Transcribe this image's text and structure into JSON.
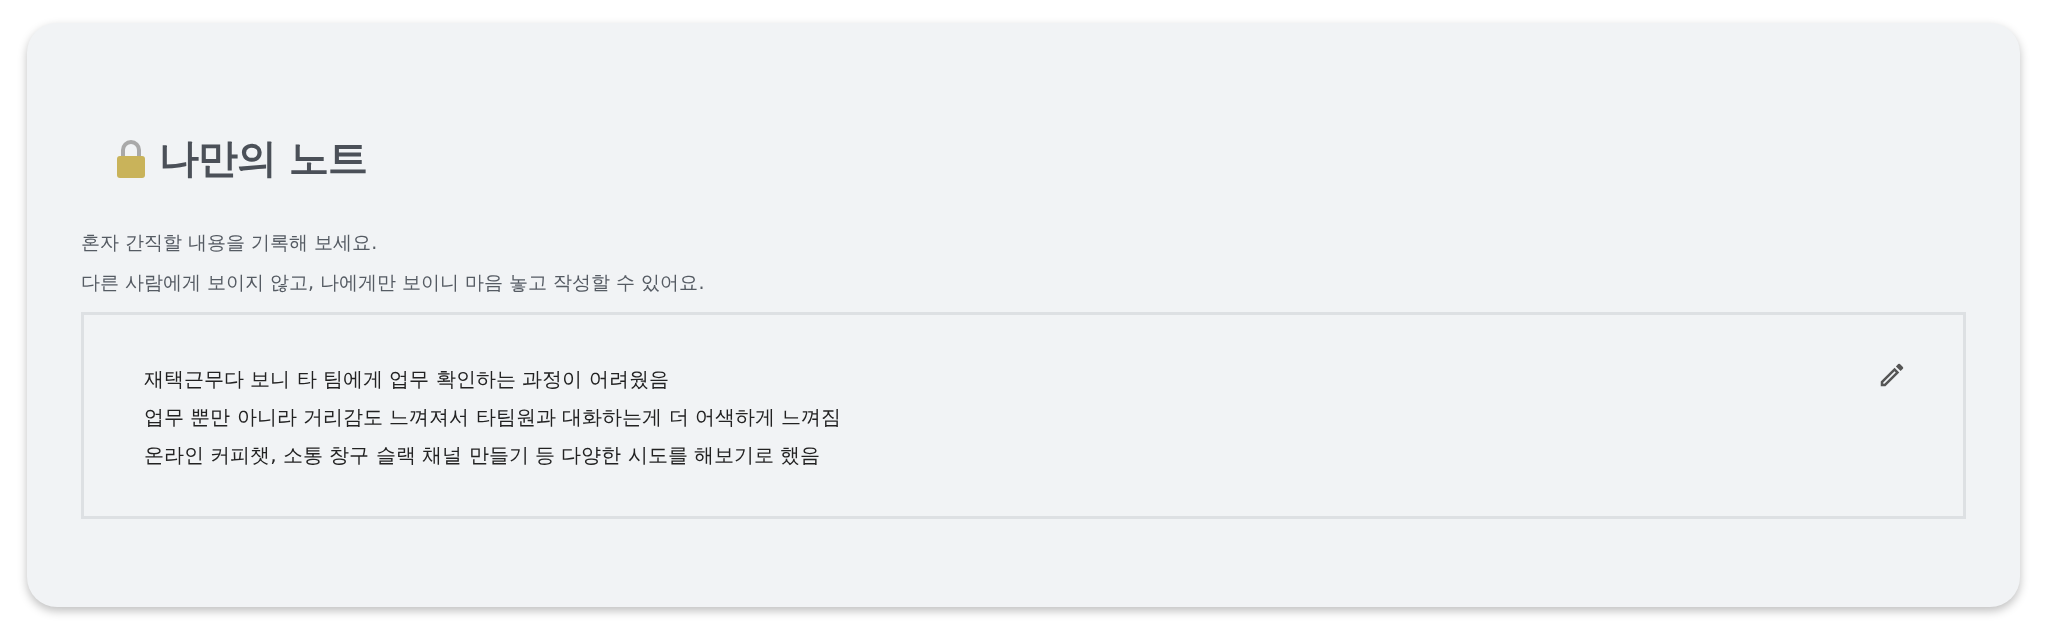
{
  "title": "나만의 노트",
  "description": [
    "혼자 간직할 내용을 기록해 보세요.",
    "다른 사람에게 보이지 않고, 나에게만 보이니 마음 놓고 작성할 수 있어요."
  ],
  "note": {
    "lines": [
      "재택근무다 보니 타 팀에게 업무 확인하는 과정이 어려웠음",
      "업무 뿐만 아니라 거리감도 느껴져서 타팀원과 대화하는게 더 어색하게 느껴짐",
      "온라인 커피챗, 소통 창구 슬랙 채널 만들기 등 다양한 시도를 해보기로 했음"
    ]
  }
}
